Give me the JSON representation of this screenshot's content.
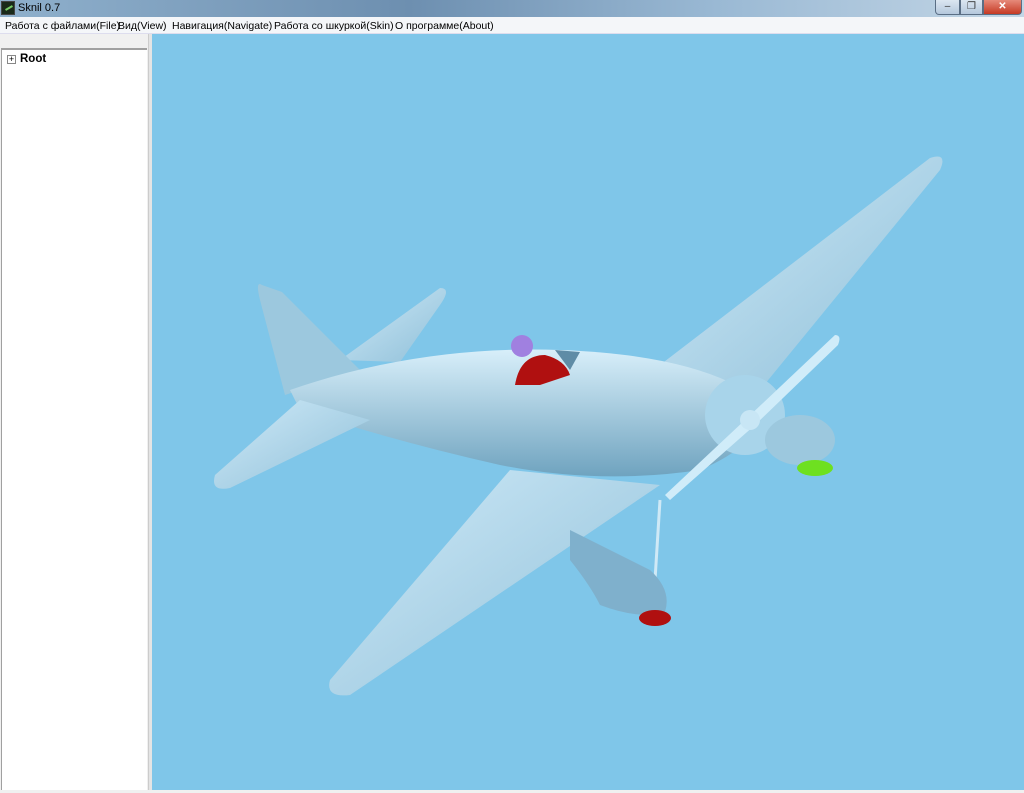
{
  "window": {
    "title": "Sknil 0.7",
    "minimize": "–",
    "maximize": "❐",
    "close": "✕"
  },
  "menu": [
    {
      "label": "Работа с файлами(File)"
    },
    {
      "label": "Вид(View)"
    },
    {
      "label": "Навигация(Navigate)"
    },
    {
      "label": "Работа со шкуркой(Skin)"
    },
    {
      "label": "О программе(About)"
    }
  ],
  "tree": {
    "expander": "+",
    "root": "Root"
  },
  "colors": {
    "sky": "#7fc6e9",
    "model": "#b8def2",
    "pilot_body": "#b01010",
    "pilot_helmet": "#a080e0",
    "prop_tip": "#6ee020",
    "wheel": "#b01010"
  }
}
